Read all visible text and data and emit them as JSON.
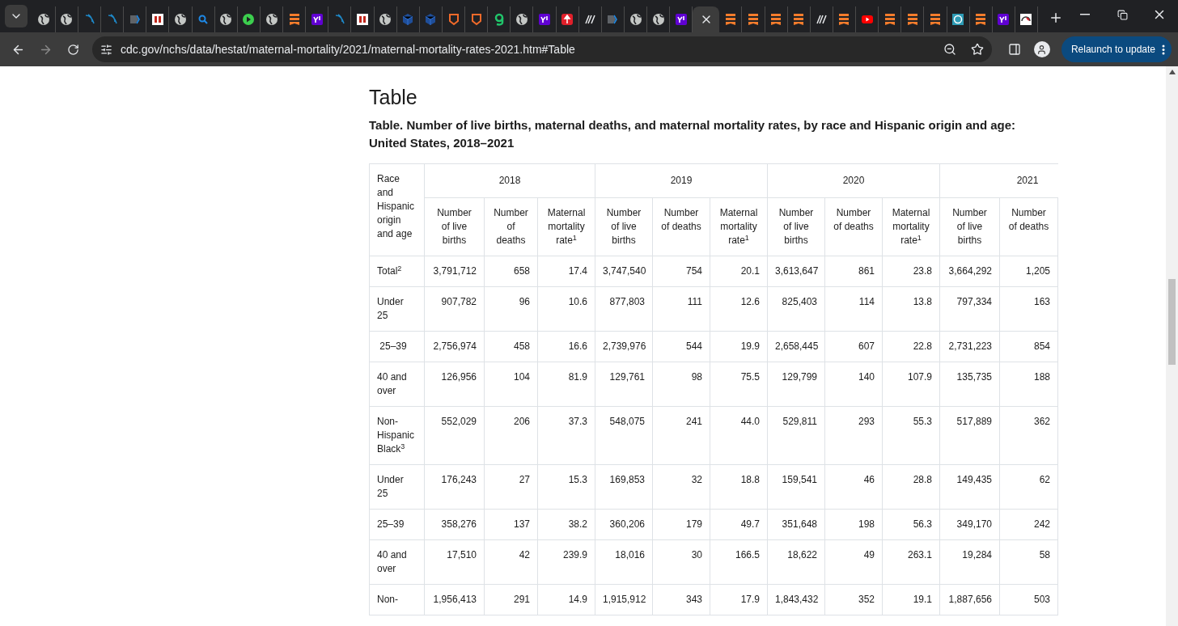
{
  "browser": {
    "tabs": [
      {
        "kind": "globe",
        "selected": false
      },
      {
        "kind": "globe",
        "selected": false
      },
      {
        "kind": "wing",
        "selected": false
      },
      {
        "kind": "wing",
        "selected": false
      },
      {
        "kind": "chevron",
        "selected": false
      },
      {
        "kind": "redlogo",
        "selected": false
      },
      {
        "kind": "globe",
        "selected": false
      },
      {
        "kind": "search",
        "selected": false
      },
      {
        "kind": "globe",
        "selected": false
      },
      {
        "kind": "play",
        "selected": false
      },
      {
        "kind": "globe",
        "selected": false
      },
      {
        "kind": "bookmark",
        "selected": false
      },
      {
        "kind": "purple",
        "selected": false
      },
      {
        "kind": "wing",
        "selected": false
      },
      {
        "kind": "redlogo",
        "selected": false
      },
      {
        "kind": "globe",
        "selected": false
      },
      {
        "kind": "cube",
        "selected": false
      },
      {
        "kind": "cube",
        "selected": false
      },
      {
        "kind": "shield",
        "selected": false
      },
      {
        "kind": "shield",
        "selected": false
      },
      {
        "kind": "greenlogo",
        "selected": false
      },
      {
        "kind": "globe",
        "selected": false
      },
      {
        "kind": "purple",
        "selected": false
      },
      {
        "kind": "pin",
        "selected": false
      },
      {
        "kind": "slashes",
        "selected": false
      },
      {
        "kind": "chevron",
        "selected": false
      },
      {
        "kind": "globe",
        "selected": false
      },
      {
        "kind": "globe",
        "selected": false
      },
      {
        "kind": "purple",
        "selected": false
      },
      {
        "selected": true
      },
      {
        "kind": "bookmark",
        "selected": false
      },
      {
        "kind": "bookmark",
        "selected": false
      },
      {
        "kind": "bookmark",
        "selected": false
      },
      {
        "kind": "bookmark",
        "selected": false
      },
      {
        "kind": "slashes",
        "selected": false
      },
      {
        "kind": "bookmark",
        "selected": false
      },
      {
        "kind": "video",
        "selected": false
      },
      {
        "kind": "bookmark",
        "selected": false
      },
      {
        "kind": "bookmark",
        "selected": false
      },
      {
        "kind": "bookmark",
        "selected": false
      },
      {
        "kind": "teal",
        "selected": false
      },
      {
        "kind": "bookmark",
        "selected": false
      },
      {
        "kind": "purple",
        "selected": false
      },
      {
        "kind": "gauge",
        "selected": false
      }
    ],
    "address": "cdc.gov/nchs/data/hestat/maternal-mortality/2021/maternal-mortality-rates-2021.htm#Table",
    "relaunch_button": "Relaunch to update"
  },
  "page": {
    "heading": "Table",
    "caption": "Table. Number of live births, maternal deaths, and maternal mortality rates, by race and Hispanic origin and age: United States, 2018–2021",
    "table": {
      "corner_header": "Race and Hispanic origin and age",
      "years": [
        "2018",
        "2019",
        "2020",
        "2021"
      ],
      "subheaders": [
        [
          "Number of live births",
          "Number of deaths",
          "Maternal mortality rate$^{1}$"
        ],
        [
          "Number of live births",
          "Number of deaths",
          "Maternal mortality rate$^{1}$"
        ],
        [
          "Number of live births",
          "Number of deaths",
          "Maternal mortality rate$^{1}$"
        ],
        [
          "Number of live births",
          "Number of deaths"
        ]
      ],
      "rows": [
        {
          "label": "Total$^{2}$",
          "cells": [
            "3,791,712",
            "658",
            "17.4",
            "3,747,540",
            "754",
            "20.1",
            "3,613,647",
            "861",
            "23.8",
            "3,664,292",
            "1,205"
          ]
        },
        {
          "label": "Under 25",
          "cells": [
            "907,782",
            "96",
            "10.6",
            "877,803",
            "111",
            "12.6",
            "825,403",
            "114",
            "13.8",
            "797,334",
            "163"
          ]
        },
        {
          "label": " 25–39",
          "cells": [
            "2,756,974",
            "458",
            "16.6",
            "2,739,976",
            "544",
            "19.9",
            "2,658,445",
            "607",
            "22.8",
            "2,731,223",
            "854"
          ]
        },
        {
          "label": "40 and over",
          "cells": [
            "126,956",
            "104",
            "81.9",
            "129,761",
            "98",
            "75.5",
            "129,799",
            "140",
            "107.9",
            "135,735",
            "188"
          ]
        },
        {
          "label": "Non-Hispanic Black$^{3}$",
          "cells": [
            "552,029",
            "206",
            "37.3",
            "548,075",
            "241",
            "44.0",
            "529,811",
            "293",
            "55.3",
            "517,889",
            "362"
          ]
        },
        {
          "label": "Under 25",
          "cells": [
            "176,243",
            "27",
            "15.3",
            "169,853",
            "32",
            "18.8",
            "159,541",
            "46",
            "28.8",
            "149,435",
            "62"
          ]
        },
        {
          "label": "25–39",
          "cells": [
            "358,276",
            "137",
            "38.2",
            "360,206",
            "179",
            "49.7",
            "351,648",
            "198",
            "56.3",
            "349,170",
            "242"
          ]
        },
        {
          "label": "40 and over",
          "cells": [
            "17,510",
            "42",
            "239.9",
            "18,016",
            "30",
            "166.5",
            "18,622",
            "49",
            "263.1",
            "19,284",
            "58"
          ]
        },
        {
          "label": "Non-",
          "cells": [
            "1,956,413",
            "291",
            "14.9",
            "1,915,912",
            "343",
            "17.9",
            "1,843,432",
            "352",
            "19.1",
            "1,887,656",
            "503"
          ]
        }
      ]
    }
  }
}
